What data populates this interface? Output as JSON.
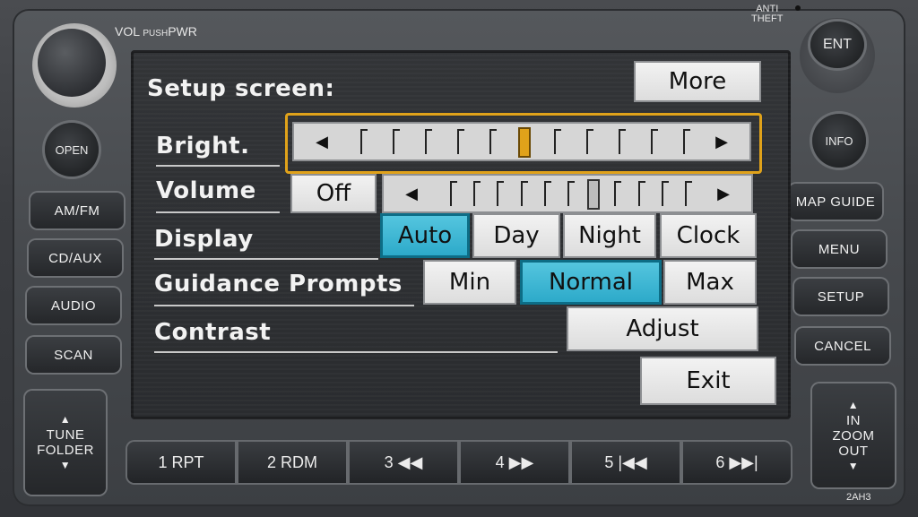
{
  "hardware": {
    "vol_label": "VOL",
    "push_label": "PUSH",
    "pwr_label": "PWR",
    "anti_theft_line1": "ANTI",
    "anti_theft_line2": "THEFT",
    "ent": "ENT",
    "open": "OPEN",
    "info": "INFO",
    "left_buttons": [
      "AM/FM",
      "CD/AUX",
      "AUDIO",
      "SCAN"
    ],
    "right_buttons": [
      "MAP GUIDE",
      "MENU",
      "SETUP",
      "CANCEL"
    ],
    "tune_folder_line1": "TUNE",
    "tune_folder_line2": "FOLDER",
    "zoom_in": "IN",
    "zoom_label": "ZOOM",
    "zoom_out": "OUT",
    "presets": [
      "1 RPT",
      "2 RDM",
      "3 ◀◀",
      "4 ▶▶",
      "5 |◀◀",
      "6 ▶▶|"
    ],
    "model_code": "2AH3"
  },
  "screen": {
    "title": "Setup screen:",
    "more": "More",
    "rows": {
      "bright_label": "Bright.",
      "volume_label": "Volume",
      "volume_off": "Off",
      "display_label": "Display",
      "display_options": [
        "Auto",
        "Day",
        "Night",
        "Clock"
      ],
      "display_selected": "Auto",
      "guidance_label": "Guidance Prompts",
      "guidance_options": [
        "Min",
        "Normal",
        "Max"
      ],
      "guidance_selected": "Normal",
      "contrast_label": "Contrast",
      "adjust": "Adjust",
      "exit": "Exit"
    },
    "brightness_level": 0.5,
    "volume_level": 0.6
  },
  "colors": {
    "selected": "#2aa8c8",
    "focus": "#e0a21a"
  }
}
